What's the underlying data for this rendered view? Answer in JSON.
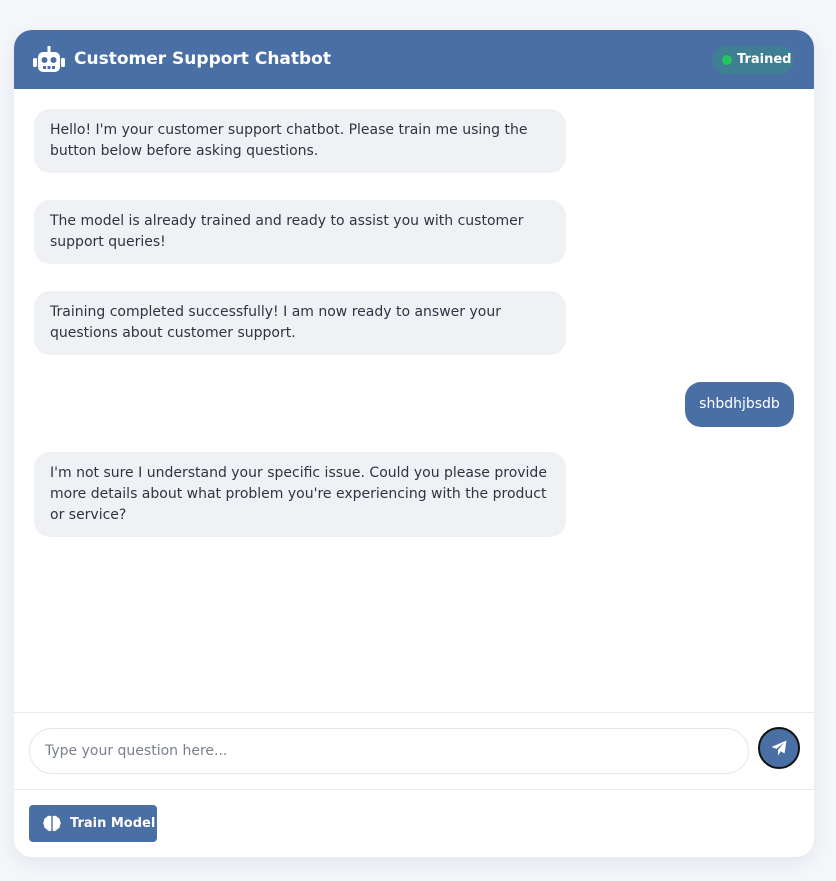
{
  "header": {
    "title": "Customer Support Chatbot",
    "bot_icon": "robot-icon",
    "status_label": "Trained",
    "status_color": "#22c55e"
  },
  "messages": [
    {
      "sender": "bot",
      "text": "Hello! I'm your customer support chatbot. Please train me using the button below before asking questions."
    },
    {
      "sender": "bot",
      "text": "The model is already trained and ready to assist you with customer support queries!"
    },
    {
      "sender": "bot",
      "text": "Training completed successfully! I am now ready to answer your questions about customer support."
    },
    {
      "sender": "user",
      "text": "shbdhjbsdb"
    },
    {
      "sender": "bot",
      "text": "I'm not sure I understand your specific issue. Could you please provide more details about what problem you're experiencing with the product or service?"
    }
  ],
  "composer": {
    "placeholder": "Type your question here...",
    "value": "",
    "send_icon": "paper-plane-icon"
  },
  "train_button": {
    "label": "Train Model",
    "icon": "brain-icon"
  },
  "colors": {
    "primary": "#4a6fa5",
    "bot_bubble": "#eff1f5",
    "page_background": "#f4f6fa"
  }
}
